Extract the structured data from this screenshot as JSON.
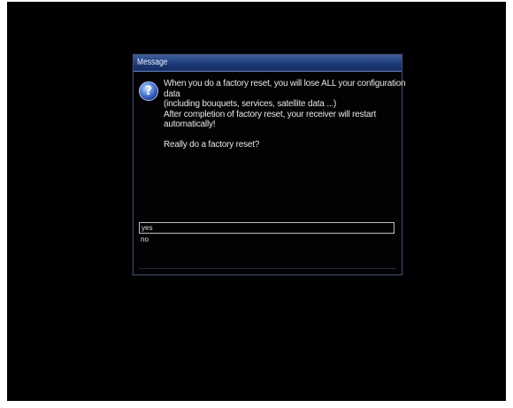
{
  "dialog": {
    "title": "Message",
    "icon": "question-icon",
    "icon_glyph": "?",
    "message_lines": [
      "When you do a factory reset, you will lose ALL your configuration",
      "data",
      "(including bouquets, services, satellite data ...)",
      "After completion of factory reset, your receiver will restart",
      "automatically!"
    ],
    "question": "Really do a factory reset?",
    "options": [
      "yes",
      "no"
    ],
    "selected_option": "yes"
  },
  "colors": {
    "screen_bg": "#000000",
    "title_bar": "#1d3a78",
    "text": "#e6e6e6",
    "selection_border": "#bfbfbf"
  }
}
